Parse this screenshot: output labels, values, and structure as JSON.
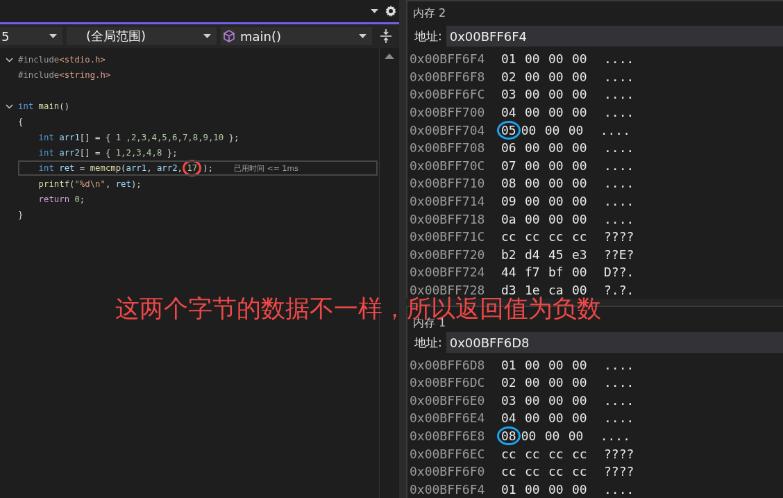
{
  "toolbar": {
    "dropdowns": [
      {
        "kind": "plain",
        "value": "5"
      },
      {
        "kind": "plain",
        "value": "(全局范围)"
      },
      {
        "kind": "function",
        "value": "main()"
      }
    ]
  },
  "code": {
    "lines": [
      {
        "fold": true,
        "tokens": [
          {
            "kind": "preproc",
            "text": "#include"
          },
          {
            "kind": "path",
            "text": "<stdio.h>"
          }
        ]
      },
      {
        "tokens": [
          {
            "kind": "preproc",
            "text": "#include"
          },
          {
            "kind": "path",
            "text": "<string.h>"
          }
        ]
      },
      {
        "kind": "blank"
      },
      {
        "fold": true,
        "tokens": [
          {
            "kind": "keyword",
            "text": "int"
          },
          {
            "kind": "func",
            "text": " main"
          },
          {
            "kind": "plain",
            "text": "()"
          }
        ]
      },
      {
        "tokens": [
          {
            "kind": "plain",
            "text": "{"
          }
        ]
      },
      {
        "tokens": [
          {
            "kind": "keyword",
            "text": "    int"
          },
          {
            "kind": "ident",
            "text": " arr1"
          },
          {
            "kind": "plain",
            "text": "[] = { "
          },
          {
            "kind": "number",
            "text": "1 ,2,3,4,5,6,7,8,9,10"
          },
          {
            "kind": "plain",
            "text": " };"
          }
        ]
      },
      {
        "tokens": [
          {
            "kind": "keyword",
            "text": "    int"
          },
          {
            "kind": "ident",
            "text": " arr2"
          },
          {
            "kind": "plain",
            "text": "[] = { "
          },
          {
            "kind": "number",
            "text": "1,2,3,4,8"
          },
          {
            "kind": "plain",
            "text": " };"
          }
        ]
      },
      {
        "current": true,
        "hint": "已用时间 <= 1ms",
        "tokens": [
          {
            "kind": "keyword",
            "text": "    int"
          },
          {
            "kind": "ident",
            "text": " ret"
          },
          {
            "kind": "plain",
            "text": " = "
          },
          {
            "kind": "func",
            "text": "memcmp"
          },
          {
            "kind": "plain",
            "text": "("
          },
          {
            "kind": "ident",
            "text": "arr1"
          },
          {
            "kind": "plain",
            "text": ", "
          },
          {
            "kind": "ident",
            "text": "arr2"
          },
          {
            "kind": "plain",
            "text": ", "
          },
          {
            "kind": "number",
            "text": "17",
            "circled": true
          },
          {
            "kind": "plain",
            "text": ");"
          }
        ]
      },
      {
        "tokens": [
          {
            "kind": "func",
            "text": "    printf"
          },
          {
            "kind": "plain",
            "text": "("
          },
          {
            "kind": "string",
            "text": "\"%d\\n\""
          },
          {
            "kind": "plain",
            "text": ", "
          },
          {
            "kind": "ident",
            "text": "ret"
          },
          {
            "kind": "plain",
            "text": ");"
          }
        ]
      },
      {
        "tokens": [
          {
            "kind": "control",
            "text": "    return"
          },
          {
            "kind": "number",
            "text": " 0"
          },
          {
            "kind": "plain",
            "text": ";"
          }
        ]
      },
      {
        "tokens": [
          {
            "kind": "plain",
            "text": "}"
          }
        ]
      }
    ]
  },
  "annotation": "这两个字节的数据不一样，所以返回值为负数",
  "memory_windows": [
    {
      "title": "内存 2",
      "address_label": "地址:",
      "address": "0x00BFF6F4",
      "rows": [
        {
          "address": "0x00BFF6F4",
          "bytes": [
            "01",
            "00",
            "00",
            "00"
          ],
          "ascii": "....",
          "marked": false
        },
        {
          "address": "0x00BFF6F8",
          "bytes": [
            "02",
            "00",
            "00",
            "00"
          ],
          "ascii": "....",
          "marked": false
        },
        {
          "address": "0x00BFF6FC",
          "bytes": [
            "03",
            "00",
            "00",
            "00"
          ],
          "ascii": "....",
          "marked": false
        },
        {
          "address": "0x00BFF700",
          "bytes": [
            "04",
            "00",
            "00",
            "00"
          ],
          "ascii": "....",
          "marked": false
        },
        {
          "address": "0x00BFF704",
          "bytes": [
            "05",
            "00",
            "00",
            "00"
          ],
          "ascii": "....",
          "marked": true
        },
        {
          "address": "0x00BFF708",
          "bytes": [
            "06",
            "00",
            "00",
            "00"
          ],
          "ascii": "....",
          "marked": false
        },
        {
          "address": "0x00BFF70C",
          "bytes": [
            "07",
            "00",
            "00",
            "00"
          ],
          "ascii": "....",
          "marked": false
        },
        {
          "address": "0x00BFF710",
          "bytes": [
            "08",
            "00",
            "00",
            "00"
          ],
          "ascii": "....",
          "marked": false
        },
        {
          "address": "0x00BFF714",
          "bytes": [
            "09",
            "00",
            "00",
            "00"
          ],
          "ascii": "....",
          "marked": false
        },
        {
          "address": "0x00BFF718",
          "bytes": [
            "0a",
            "00",
            "00",
            "00"
          ],
          "ascii": "....",
          "marked": false
        },
        {
          "address": "0x00BFF71C",
          "bytes": [
            "cc",
            "cc",
            "cc",
            "cc"
          ],
          "ascii": "????",
          "marked": false
        },
        {
          "address": "0x00BFF720",
          "bytes": [
            "b2",
            "d4",
            "45",
            "e3"
          ],
          "ascii": "??E?",
          "marked": false
        },
        {
          "address": "0x00BFF724",
          "bytes": [
            "44",
            "f7",
            "bf",
            "00"
          ],
          "ascii": "D??.",
          "marked": false
        },
        {
          "address": "0x00BFF728",
          "bytes": [
            "d3",
            "1e",
            "ca",
            "00"
          ],
          "ascii": "?.?.",
          "marked": false
        }
      ]
    },
    {
      "title": "内存 1",
      "address_label": "地址:",
      "address": "0x00BFF6D8",
      "rows": [
        {
          "address": "0x00BFF6D8",
          "bytes": [
            "01",
            "00",
            "00",
            "00"
          ],
          "ascii": "....",
          "marked": false
        },
        {
          "address": "0x00BFF6DC",
          "bytes": [
            "02",
            "00",
            "00",
            "00"
          ],
          "ascii": "....",
          "marked": false
        },
        {
          "address": "0x00BFF6E0",
          "bytes": [
            "03",
            "00",
            "00",
            "00"
          ],
          "ascii": "....",
          "marked": false
        },
        {
          "address": "0x00BFF6E4",
          "bytes": [
            "04",
            "00",
            "00",
            "00"
          ],
          "ascii": "....",
          "marked": false
        },
        {
          "address": "0x00BFF6E8",
          "bytes": [
            "08",
            "00",
            "00",
            "00"
          ],
          "ascii": "....",
          "marked": true
        },
        {
          "address": "0x00BFF6EC",
          "bytes": [
            "cc",
            "cc",
            "cc",
            "cc"
          ],
          "ascii": "????",
          "marked": false
        },
        {
          "address": "0x00BFF6F0",
          "bytes": [
            "cc",
            "cc",
            "cc",
            "cc"
          ],
          "ascii": "????",
          "marked": false
        },
        {
          "address": "0x00BFF6F4",
          "bytes": [
            "01",
            "00",
            "00",
            "00"
          ],
          "ascii": "....",
          "marked": false
        }
      ]
    }
  ]
}
